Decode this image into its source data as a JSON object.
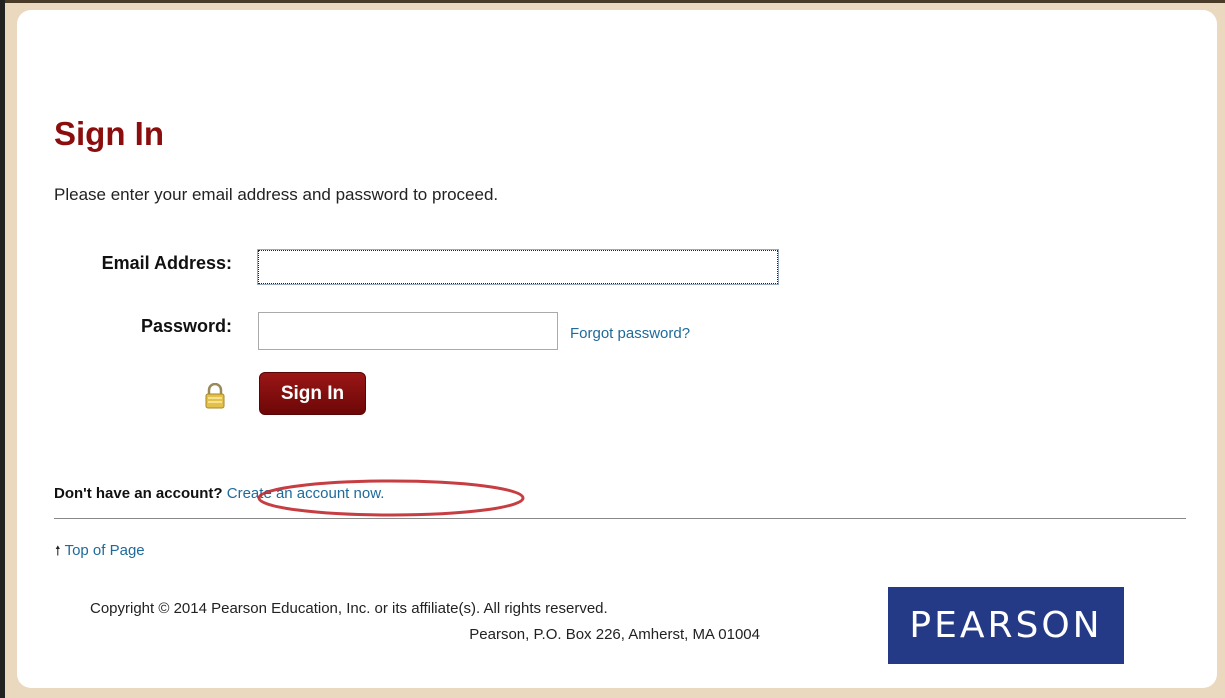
{
  "page": {
    "title": "Sign In",
    "intro": "Please enter your email address and password to proceed."
  },
  "form": {
    "email_label": "Email Address:",
    "email_value": "",
    "password_label": "Password:",
    "password_value": "",
    "forgot_password": "Forgot password?",
    "submit_label": "Sign In",
    "lock_icon": "lock-icon"
  },
  "account": {
    "prompt": "Don't have an account?",
    "create_link": "Create an account now.",
    "annotation_color": "#c0282d"
  },
  "footer": {
    "top_of_page": "Top of Page",
    "copyright": "Copyright © 2014 Pearson Education, Inc. or its affiliate(s). All rights reserved.",
    "address": "Pearson, P.O. Box 226, Amherst, MA 01004",
    "logo_text": "PEARSON"
  },
  "colors": {
    "accent": "#8b0d0d",
    "link": "#1e6a9a",
    "logo_bg": "#253a86",
    "background": "#ead9bf"
  }
}
